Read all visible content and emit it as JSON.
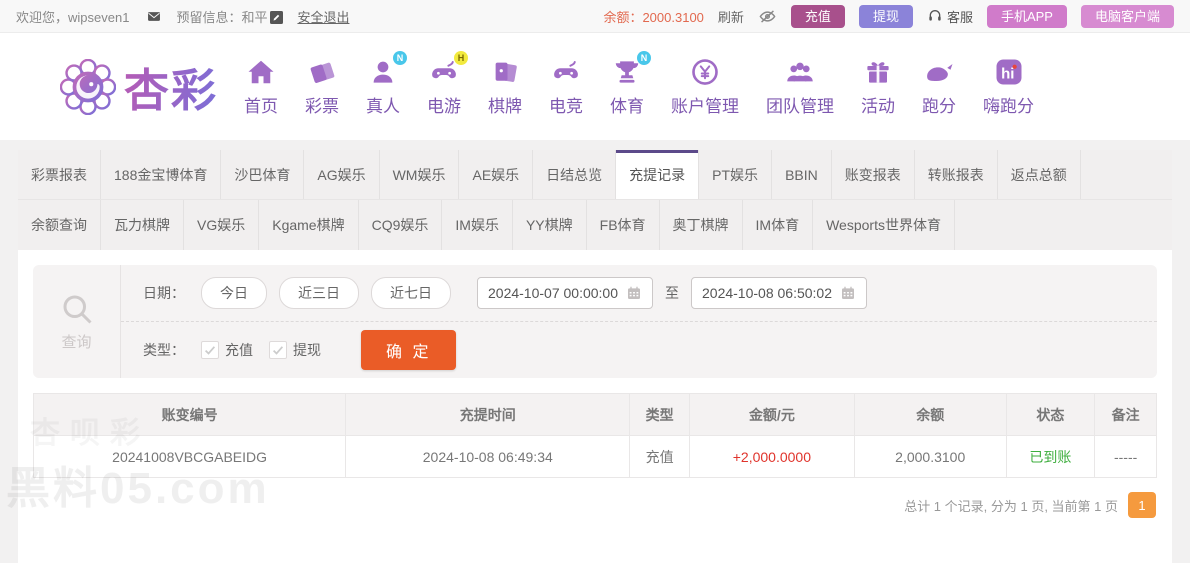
{
  "topbar": {
    "welcome": "欢迎您，wipseven1",
    "reserved_info": "预留信息：和平",
    "logout": "安全退出",
    "balance_label": "余额：",
    "balance_value": "2000.3100",
    "refresh": "刷新",
    "deposit": "充值",
    "withdraw": "提现",
    "service": "客服",
    "mobile_app": "手机APP",
    "pc_client": "电脑客户端"
  },
  "nav": {
    "logo_text": "杏彩",
    "items": [
      {
        "label": "首页",
        "icon": "home-icon",
        "badge": ""
      },
      {
        "label": "彩票",
        "icon": "ticket-icon",
        "badge": ""
      },
      {
        "label": "真人",
        "icon": "live-person-icon",
        "badge": "N"
      },
      {
        "label": "电游",
        "icon": "gamepad-icon",
        "badge": "H"
      },
      {
        "label": "棋牌",
        "icon": "cards-icon",
        "badge": ""
      },
      {
        "label": "电竞",
        "icon": "esports-icon",
        "badge": ""
      },
      {
        "label": "体育",
        "icon": "trophy-icon",
        "badge": "N"
      },
      {
        "label": "账户管理",
        "icon": "coin-icon",
        "badge": ""
      },
      {
        "label": "团队管理",
        "icon": "team-icon",
        "badge": ""
      },
      {
        "label": "活动",
        "icon": "gift-icon",
        "badge": ""
      },
      {
        "label": "跑分",
        "icon": "rhino-icon",
        "badge": ""
      },
      {
        "label": "嗨跑分",
        "icon": "hi-icon",
        "badge": ""
      }
    ]
  },
  "tabs": {
    "active": "充提记录",
    "row1": [
      "彩票报表",
      "188金宝博体育",
      "沙巴体育",
      "AG娱乐",
      "WM娱乐",
      "AE娱乐",
      "日结总览",
      "充提记录",
      "PT娱乐",
      "BBIN",
      "账变报表",
      "转账报表",
      "返点总额"
    ],
    "row2": [
      "余额查询",
      "瓦力棋牌",
      "VG娱乐",
      "Kgame棋牌",
      "CQ9娱乐",
      "IM娱乐",
      "YY棋牌",
      "FB体育",
      "奥丁棋牌",
      "IM体育",
      "Wesports世界体育"
    ]
  },
  "filter": {
    "query_label": "查询",
    "date_label": "日期：",
    "quick_ranges": [
      "今日",
      "近三日",
      "近七日"
    ],
    "date_from": "2024-10-07 00:00:00",
    "to_label": "至",
    "date_to": "2024-10-08 06:50:02",
    "type_label": "类型：",
    "type_options": [
      {
        "label": "充值",
        "checked": true
      },
      {
        "label": "提现",
        "checked": true
      }
    ],
    "submit": "确 定"
  },
  "table": {
    "headers": [
      "账变编号",
      "充提时间",
      "类型",
      "金额/元",
      "余额",
      "状态",
      "备注"
    ],
    "rows": [
      {
        "id": "20241008VBCGABEIDG",
        "time": "2024-10-08 06:49:34",
        "type": "充值",
        "amount": "+2,000.0000",
        "balance": "2,000.3100",
        "status": "已到账",
        "remark": "-----"
      }
    ]
  },
  "pagination": {
    "summary": "总计 1 个记录, 分为 1 页, 当前第 1 页",
    "current_page": "1"
  },
  "watermark": "黑料05.com",
  "colors": {
    "accent_purple": "#7e58b0",
    "tab_active_border": "#5c4a8a",
    "deposit_btn": "#a8508c",
    "withdraw_btn": "#8b83d9",
    "app_btn": "#d07bca",
    "submit_btn": "#ea5c27",
    "balance_text": "#e2694f",
    "amount_red": "#e0342c",
    "status_green": "#3eae3e",
    "page_btn_orange": "#f59a3e"
  }
}
